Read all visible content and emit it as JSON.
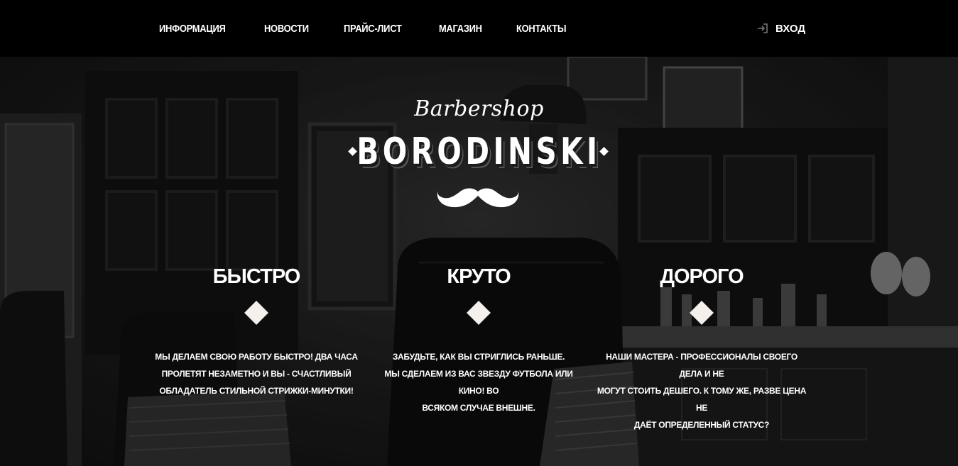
{
  "nav": {
    "items": [
      "ИНФОРМАЦИЯ",
      "НОВОСТИ",
      "ПРАЙС-ЛИСТ",
      "МАГАЗИН",
      "КОНТАКТЫ"
    ],
    "login_label": "ВХОД"
  },
  "logo": {
    "script": "Barbershop",
    "name": "BORODINSKI"
  },
  "features": [
    {
      "title": "БЫСТРО",
      "lines": [
        "МЫ ДЕЛАЕМ СВОЮ РАБОТУ БЫСТРО! ДВА ЧАСА",
        "ПРОЛЕТЯТ НЕЗАМЕТНО И ВЫ - СЧАСТЛИВЫЙ",
        "ОБЛАДАТЕЛЬ СТИЛЬНОЙ СТРИЖКИ-МИНУТКИ!"
      ]
    },
    {
      "title": "КРУТО",
      "lines": [
        "ЗАБУДЬТЕ, КАК ВЫ СТРИГЛИСЬ РАНЬШЕ.",
        "МЫ СДЕЛАЕМ ИЗ ВАС ЗВЕЗДУ ФУТБОЛА ИЛИ КИНО! ВО",
        "ВСЯКОМ СЛУЧАЕ ВНЕШНЕ."
      ]
    },
    {
      "title": "ДОРОГО",
      "lines": [
        "НАШИ МАСТЕРА - ПРОФЕССИОНАЛЫ СВОЕГО ДЕЛА И НЕ",
        "МОГУТ СТОИТЬ ДЕШЕГО. К ТОМУ ЖЕ, РАЗВЕ ЦЕНА НЕ",
        "ДАЁТ ОПРЕДЕЛЕННЫЙ СТАТУС?"
      ]
    }
  ],
  "icons": {
    "login": "login-icon",
    "mustache": "mustache-icon"
  }
}
